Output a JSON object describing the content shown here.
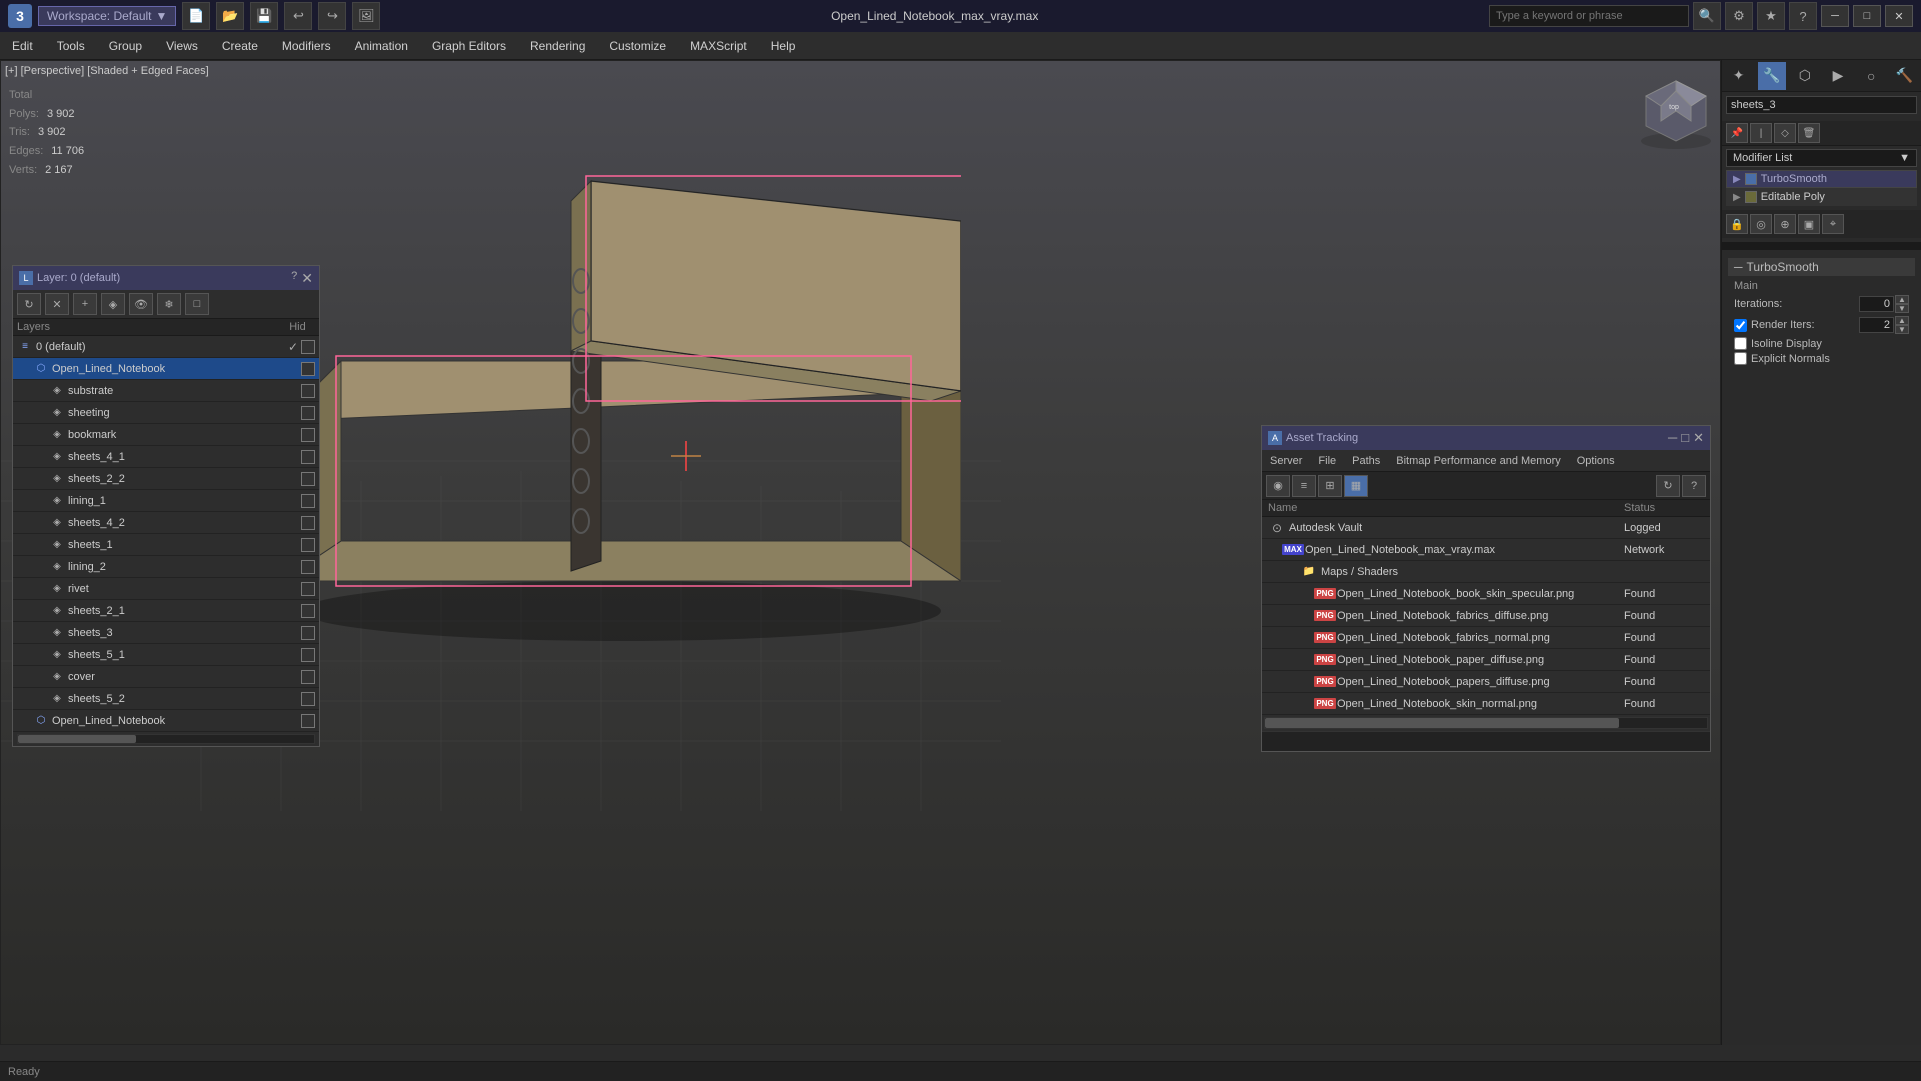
{
  "titlebar": {
    "title": "Open_Lined_Notebook_max_vray.max",
    "workspace": "Workspace: Default",
    "search_placeholder": "Type a keyword or phrase"
  },
  "menu": {
    "items": [
      "Edit",
      "Tools",
      "Group",
      "Views",
      "Create",
      "Modifiers",
      "Animation",
      "Graph Editors",
      "Rendering",
      "Customize",
      "MAXScript",
      "Help"
    ]
  },
  "viewport": {
    "label": "[+] [Perspective] [Shaded + Edged Faces]",
    "stats": {
      "polys_label": "Polys:",
      "polys_val": "3 902",
      "tris_label": "Tris:",
      "tris_val": "3 902",
      "edges_label": "Edges:",
      "edges_val": "11 706",
      "verts_label": "Verts:",
      "verts_val": "2 167",
      "total_label": "Total"
    }
  },
  "modifier_panel": {
    "object_name": "sheets_3",
    "modifier_list_label": "Modifier List",
    "turbosmooth_label": "TurboSmooth",
    "editable_poly_label": "Editable Poly",
    "turbosmooth_section": {
      "title": "TurboSmooth",
      "main_label": "Main",
      "iterations_label": "Iterations:",
      "iterations_val": "0",
      "render_iters_label": "Render Iters:",
      "render_iters_val": "2",
      "isoline_label": "Isoline Display",
      "explicit_label": "Explicit Normals"
    }
  },
  "layer_panel": {
    "title": "Layer: 0 (default)",
    "help_label": "?",
    "columns": {
      "name": "Layers",
      "hidden": "Hid"
    },
    "layers": [
      {
        "name": "0 (default)",
        "indent": 0,
        "type": "layer",
        "checked": true,
        "selected": false
      },
      {
        "name": "Open_Lined_Notebook",
        "indent": 1,
        "type": "group",
        "selected": true
      },
      {
        "name": "substrate",
        "indent": 2,
        "type": "object",
        "selected": false
      },
      {
        "name": "sheeting",
        "indent": 2,
        "type": "object",
        "selected": false
      },
      {
        "name": "bookmark",
        "indent": 2,
        "type": "object",
        "selected": false
      },
      {
        "name": "sheets_4_1",
        "indent": 2,
        "type": "object",
        "selected": false
      },
      {
        "name": "sheets_2_2",
        "indent": 2,
        "type": "object",
        "selected": false
      },
      {
        "name": "lining_1",
        "indent": 2,
        "type": "object",
        "selected": false
      },
      {
        "name": "sheets_4_2",
        "indent": 2,
        "type": "object",
        "selected": false
      },
      {
        "name": "sheets_1",
        "indent": 2,
        "type": "object",
        "selected": false
      },
      {
        "name": "lining_2",
        "indent": 2,
        "type": "object",
        "selected": false
      },
      {
        "name": "rivet",
        "indent": 2,
        "type": "object",
        "selected": false
      },
      {
        "name": "sheets_2_1",
        "indent": 2,
        "type": "object",
        "selected": false
      },
      {
        "name": "sheets_3",
        "indent": 2,
        "type": "object",
        "selected": false
      },
      {
        "name": "sheets_5_1",
        "indent": 2,
        "type": "object",
        "selected": false
      },
      {
        "name": "cover",
        "indent": 2,
        "type": "object",
        "selected": false
      },
      {
        "name": "sheets_5_2",
        "indent": 2,
        "type": "object",
        "selected": false
      },
      {
        "name": "Open_Lined_Notebook",
        "indent": 1,
        "type": "group2",
        "selected": false
      }
    ]
  },
  "asset_panel": {
    "title": "Asset Tracking",
    "menus": [
      "Server",
      "File",
      "Paths",
      "Bitmap Performance and Memory",
      "Options"
    ],
    "columns": {
      "name": "Name",
      "status": "Status"
    },
    "items": [
      {
        "name": "Autodesk Vault",
        "indent": 0,
        "type": "vault",
        "status": "Logged"
      },
      {
        "name": "Open_Lined_Notebook_max_vray.max",
        "indent": 1,
        "type": "max",
        "status": "Network"
      },
      {
        "name": "Maps / Shaders",
        "indent": 2,
        "type": "folder",
        "status": ""
      },
      {
        "name": "Open_Lined_Notebook_book_skin_specular.png",
        "indent": 3,
        "type": "png",
        "status": "Found"
      },
      {
        "name": "Open_Lined_Notebook_fabrics_diffuse.png",
        "indent": 3,
        "type": "png",
        "status": "Found"
      },
      {
        "name": "Open_Lined_Notebook_fabrics_normal.png",
        "indent": 3,
        "type": "png",
        "status": "Found"
      },
      {
        "name": "Open_Lined_Notebook_paper_diffuse.png",
        "indent": 3,
        "type": "png",
        "status": "Found"
      },
      {
        "name": "Open_Lined_Notebook_papers_diffuse.png",
        "indent": 3,
        "type": "png",
        "status": "Found"
      },
      {
        "name": "Open_Lined_Notebook_skin_normal.png",
        "indent": 3,
        "type": "png",
        "status": "Found"
      }
    ]
  }
}
